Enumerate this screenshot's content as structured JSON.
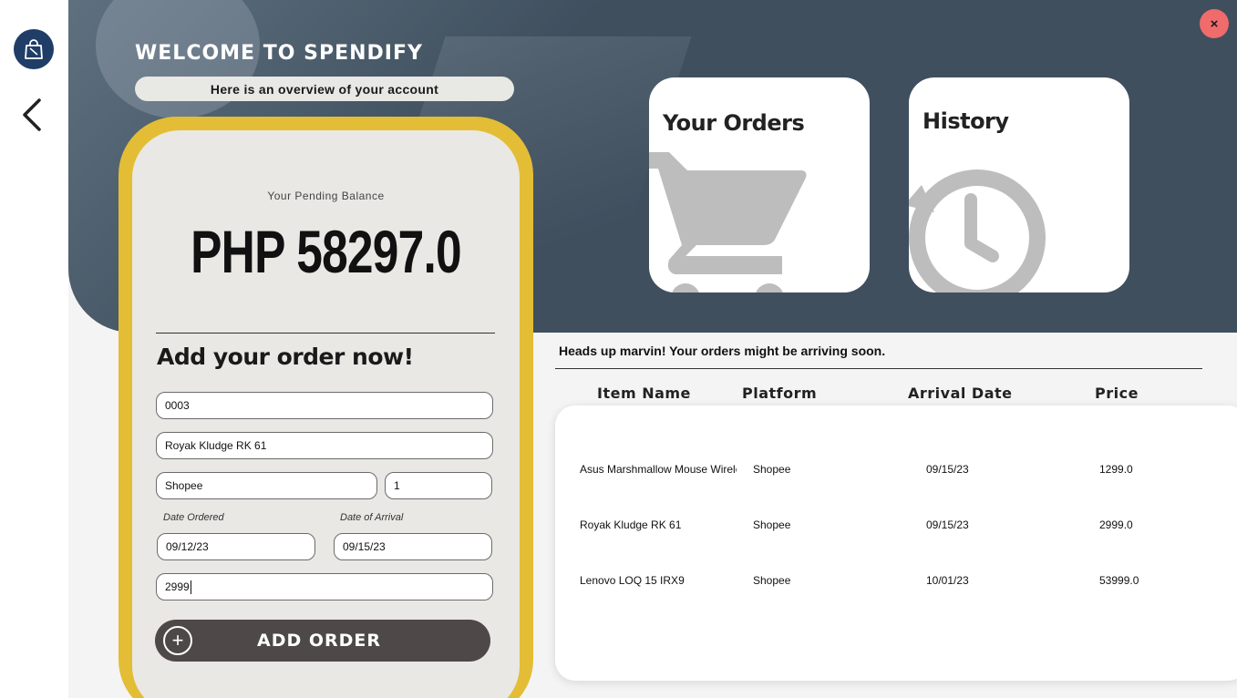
{
  "app": {
    "welcome": "WELCOME TO SPENDIFY",
    "overview": "Here is an overview of your account"
  },
  "balance": {
    "label": "Your Pending Balance",
    "amount": "PHP 58297.0"
  },
  "form": {
    "heading": "Add your order now!",
    "order_id": "0003",
    "item_name": "Royak Kludge RK 61",
    "platform": "Shopee",
    "quantity": "1",
    "date_ordered_label": "Date Ordered",
    "date_arrival_label": "Date of Arrival",
    "date_ordered": "09/12/23",
    "date_arrival": "09/15/23",
    "price": "2999",
    "add_button": "ADD ORDER",
    "plus_glyph": "+"
  },
  "tiles": {
    "orders": "Your Orders",
    "history": "History"
  },
  "close_glyph": "×",
  "orders": {
    "notice": "Heads up marvin! Your orders might be arriving soon.",
    "columns": [
      "Item Name",
      "Platform",
      "Arrival Date",
      "Price"
    ],
    "rows": [
      {
        "item": "Asus Marshmallow Mouse Wireless",
        "platform": "Shopee",
        "arrival": "09/15/23",
        "price": "1299.0"
      },
      {
        "item": "Royak Kludge RK 61",
        "platform": "Shopee",
        "arrival": "09/15/23",
        "price": "2999.0"
      },
      {
        "item": "Lenovo LOQ 15 IRX9",
        "platform": "Shopee",
        "arrival": "10/01/23",
        "price": "53999.0"
      }
    ]
  },
  "icons": {
    "logo": "shopping-bag-icon",
    "back": "chevron-left-icon",
    "close": "close-icon",
    "orders_tile": "shopping-cart-icon",
    "history_tile": "history-clock-icon",
    "add": "plus-circle-icon"
  },
  "colors": {
    "header": "#3f4f5e",
    "card_border": "#e3bd35",
    "card_bg": "#e9e8e4",
    "button": "#4e4848",
    "close": "#f06b6b",
    "logo": "#1f3d66"
  }
}
